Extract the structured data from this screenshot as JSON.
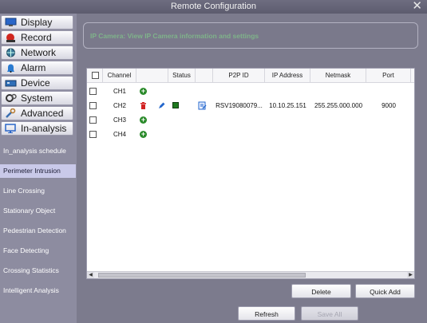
{
  "window": {
    "title": "Remote Configuration",
    "close_glyph": "✕"
  },
  "sidebar": {
    "nav": [
      {
        "label": "Display",
        "icon": "monitor-icon"
      },
      {
        "label": "Record",
        "icon": "record-icon"
      },
      {
        "label": "Network",
        "icon": "network-icon"
      },
      {
        "label": "Alarm",
        "icon": "alarm-icon"
      },
      {
        "label": "Device",
        "icon": "device-icon"
      },
      {
        "label": "System",
        "icon": "gear-icon"
      },
      {
        "label": "Advanced",
        "icon": "wrench-icon"
      },
      {
        "label": "In-analysis",
        "icon": "camera-monitor-icon"
      }
    ],
    "subitems": [
      {
        "label": "In_analysis schedule"
      },
      {
        "label": "Perimeter Intrusion",
        "selected": true
      },
      {
        "label": "Line Crossing"
      },
      {
        "label": "Stationary Object"
      },
      {
        "label": "Pedestrian Detection"
      },
      {
        "label": "Face Detecting"
      },
      {
        "label": "Crossing Statistics"
      },
      {
        "label": "Intelligent Analysis"
      }
    ]
  },
  "main": {
    "header_title": "IP Camera: View IP Camera information and settings",
    "table": {
      "columns": [
        "Channel",
        "Status",
        "P2P ID",
        "IP Address",
        "Netmask",
        "Port"
      ],
      "rows": [
        {
          "channel": "CH1",
          "p2p_id": "",
          "ip": "",
          "netmask": "",
          "port": ""
        },
        {
          "channel": "CH2",
          "p2p_id": "RSV19080079...",
          "ip": "10.10.25.151",
          "netmask": "255.255.000.000",
          "port": "9000"
        },
        {
          "channel": "CH3",
          "p2p_id": "",
          "ip": "",
          "netmask": "",
          "port": ""
        },
        {
          "channel": "CH4",
          "p2p_id": "",
          "ip": "",
          "netmask": "",
          "port": ""
        }
      ]
    },
    "buttons": {
      "delete": "Delete",
      "quick_add": "Quick Add",
      "refresh": "Refresh",
      "save_all": "Save All"
    }
  },
  "colors": {
    "header_text": "#7fb38a",
    "selected_item": "#c9c9e9",
    "add_icon": "#2a8a2a",
    "delete_icon": "#d22222",
    "edit_icon": "#2266cc",
    "status_icon": "#1f7a1f"
  }
}
